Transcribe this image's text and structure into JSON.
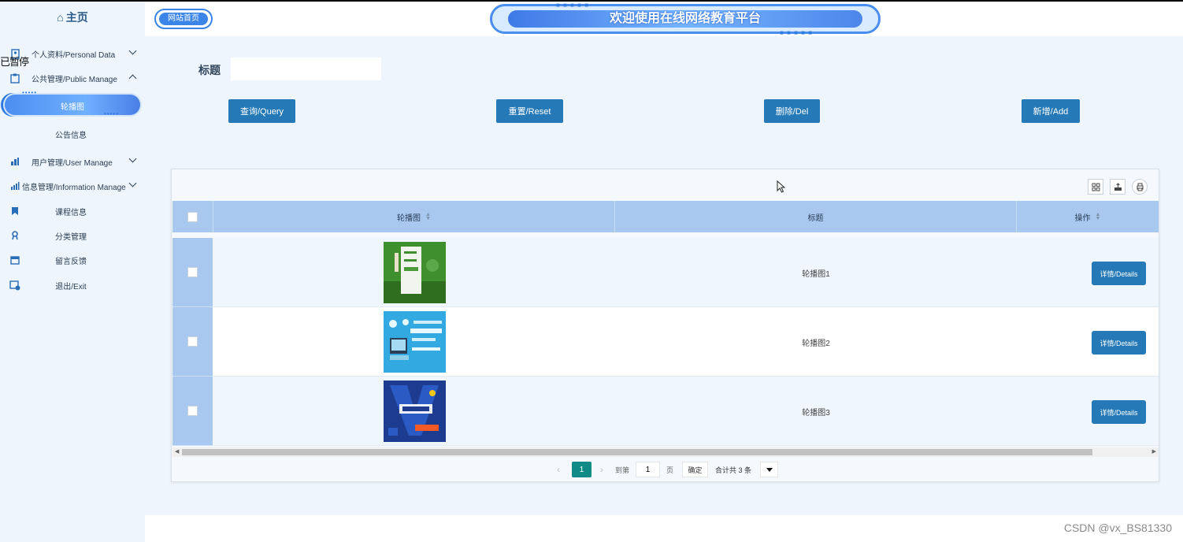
{
  "sidebar": {
    "home_label": "主页",
    "overlap_text": "已暂停",
    "items": [
      {
        "label": "个人资料/Personal Data",
        "icon": "profile-icon",
        "expanded": false
      },
      {
        "label": "公共管理/Public Manage",
        "icon": "clipboard-icon",
        "expanded": true
      },
      {
        "label": "轮播图",
        "active": true
      },
      {
        "label": "公告信息"
      },
      {
        "label": "用户管理/User Manage",
        "icon": "user-icon",
        "expanded": false
      },
      {
        "label": "信息管理/Information Manage",
        "icon": "chart-icon",
        "expanded": false
      },
      {
        "label": "课程信息",
        "icon": "bookmark-icon"
      },
      {
        "label": "分类管理",
        "icon": "category-icon"
      },
      {
        "label": "留言反馈",
        "icon": "calendar-icon"
      },
      {
        "label": "退出/Exit",
        "icon": "exit-calendar-icon"
      }
    ]
  },
  "header": {
    "site_home": "网站首页",
    "banner_title": "欢迎使用在线网络教育平台"
  },
  "search": {
    "label": "标题",
    "value": ""
  },
  "actions": {
    "query": "查询/Query",
    "reset": "重置/Reset",
    "delete": "删除/Del",
    "add": "新增/Add"
  },
  "table": {
    "columns": [
      "轮播图",
      "标题",
      "操作"
    ],
    "rows": [
      {
        "title": "轮播图1",
        "detail": "详情/Details"
      },
      {
        "title": "轮播图2",
        "detail": "详情/Details"
      },
      {
        "title": "轮播图3",
        "detail": "详情/Details"
      }
    ]
  },
  "pagination": {
    "current": "1",
    "goto_label": "到第",
    "goto_value": "1",
    "page_unit": "页",
    "confirm": "确定",
    "total": "合计共 3 条"
  },
  "watermark": "CSDN @vx_BS81330",
  "colors": {
    "primary_button": "#2479b6",
    "table_header": "#a8c8f0",
    "page_active": "#0f8a87",
    "background": "#eef5fc"
  }
}
